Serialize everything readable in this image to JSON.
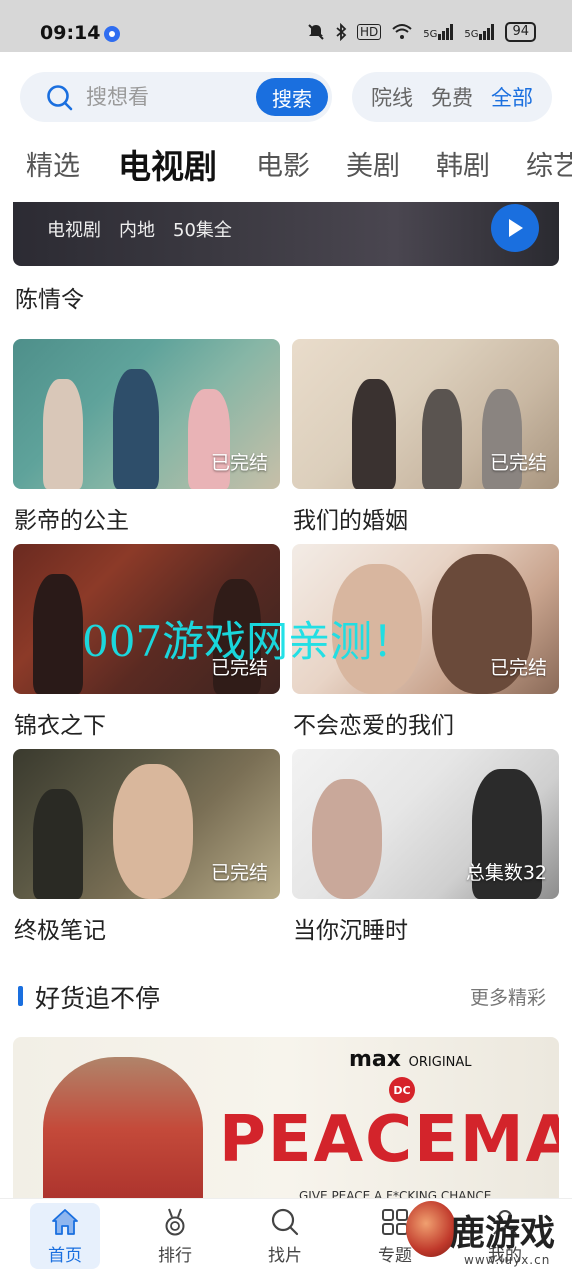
{
  "status_bar": {
    "time": "09:14",
    "network_labels": [
      "HD",
      "5G",
      "5G"
    ],
    "battery": "94"
  },
  "search": {
    "placeholder": "搜想看",
    "button_label": "搜索",
    "filters": [
      {
        "label": "院线",
        "active": false
      },
      {
        "label": "免费",
        "active": false
      },
      {
        "label": "全部",
        "active": true
      }
    ]
  },
  "channel_tabs": [
    {
      "label": "精选",
      "active": false
    },
    {
      "label": "电视剧",
      "active": true
    },
    {
      "label": "电影",
      "active": false
    },
    {
      "label": "美剧",
      "active": false
    },
    {
      "label": "韩剧",
      "active": false
    },
    {
      "label": "综艺",
      "active": false
    }
  ],
  "top_banner": {
    "tags": [
      "电视剧",
      "内地",
      "50集全"
    ],
    "title": "陈情令"
  },
  "cards": [
    {
      "title": "影帝的公主",
      "badge": "已完结"
    },
    {
      "title": "我们的婚姻",
      "badge": "已完结"
    },
    {
      "title": "锦衣之下",
      "badge": "已完结"
    },
    {
      "title": "不会恋爱的我们",
      "badge": "已完结"
    },
    {
      "title": "终极笔记",
      "badge": "已完结"
    },
    {
      "title": "当你沉睡时",
      "badge": "总集数32"
    }
  ],
  "section": {
    "title": "好货追不停",
    "more_label": "更多精彩"
  },
  "feature_banner": {
    "brand": "max",
    "brand_suffix": "ORIGINAL",
    "dc": "DC",
    "title": "PEACEMAKE",
    "tagline": "GIVE PEACE A F*CKING CHANCE"
  },
  "watermark": "007游戏网亲测！",
  "bottom_nav": [
    {
      "label": "首页",
      "icon": "home-icon",
      "active": true
    },
    {
      "label": "排行",
      "icon": "medal-icon",
      "active": false
    },
    {
      "label": "找片",
      "icon": "search-icon",
      "active": false
    },
    {
      "label": "专题",
      "icon": "grid-icon",
      "active": false
    },
    {
      "label": "我的",
      "icon": "user-icon",
      "active": false
    }
  ],
  "corner_logo": {
    "text": "鹿游戏",
    "url": "www.luyx.cn"
  },
  "colors": {
    "accent": "#1a6fdf",
    "watermark": "#18e0e6"
  }
}
